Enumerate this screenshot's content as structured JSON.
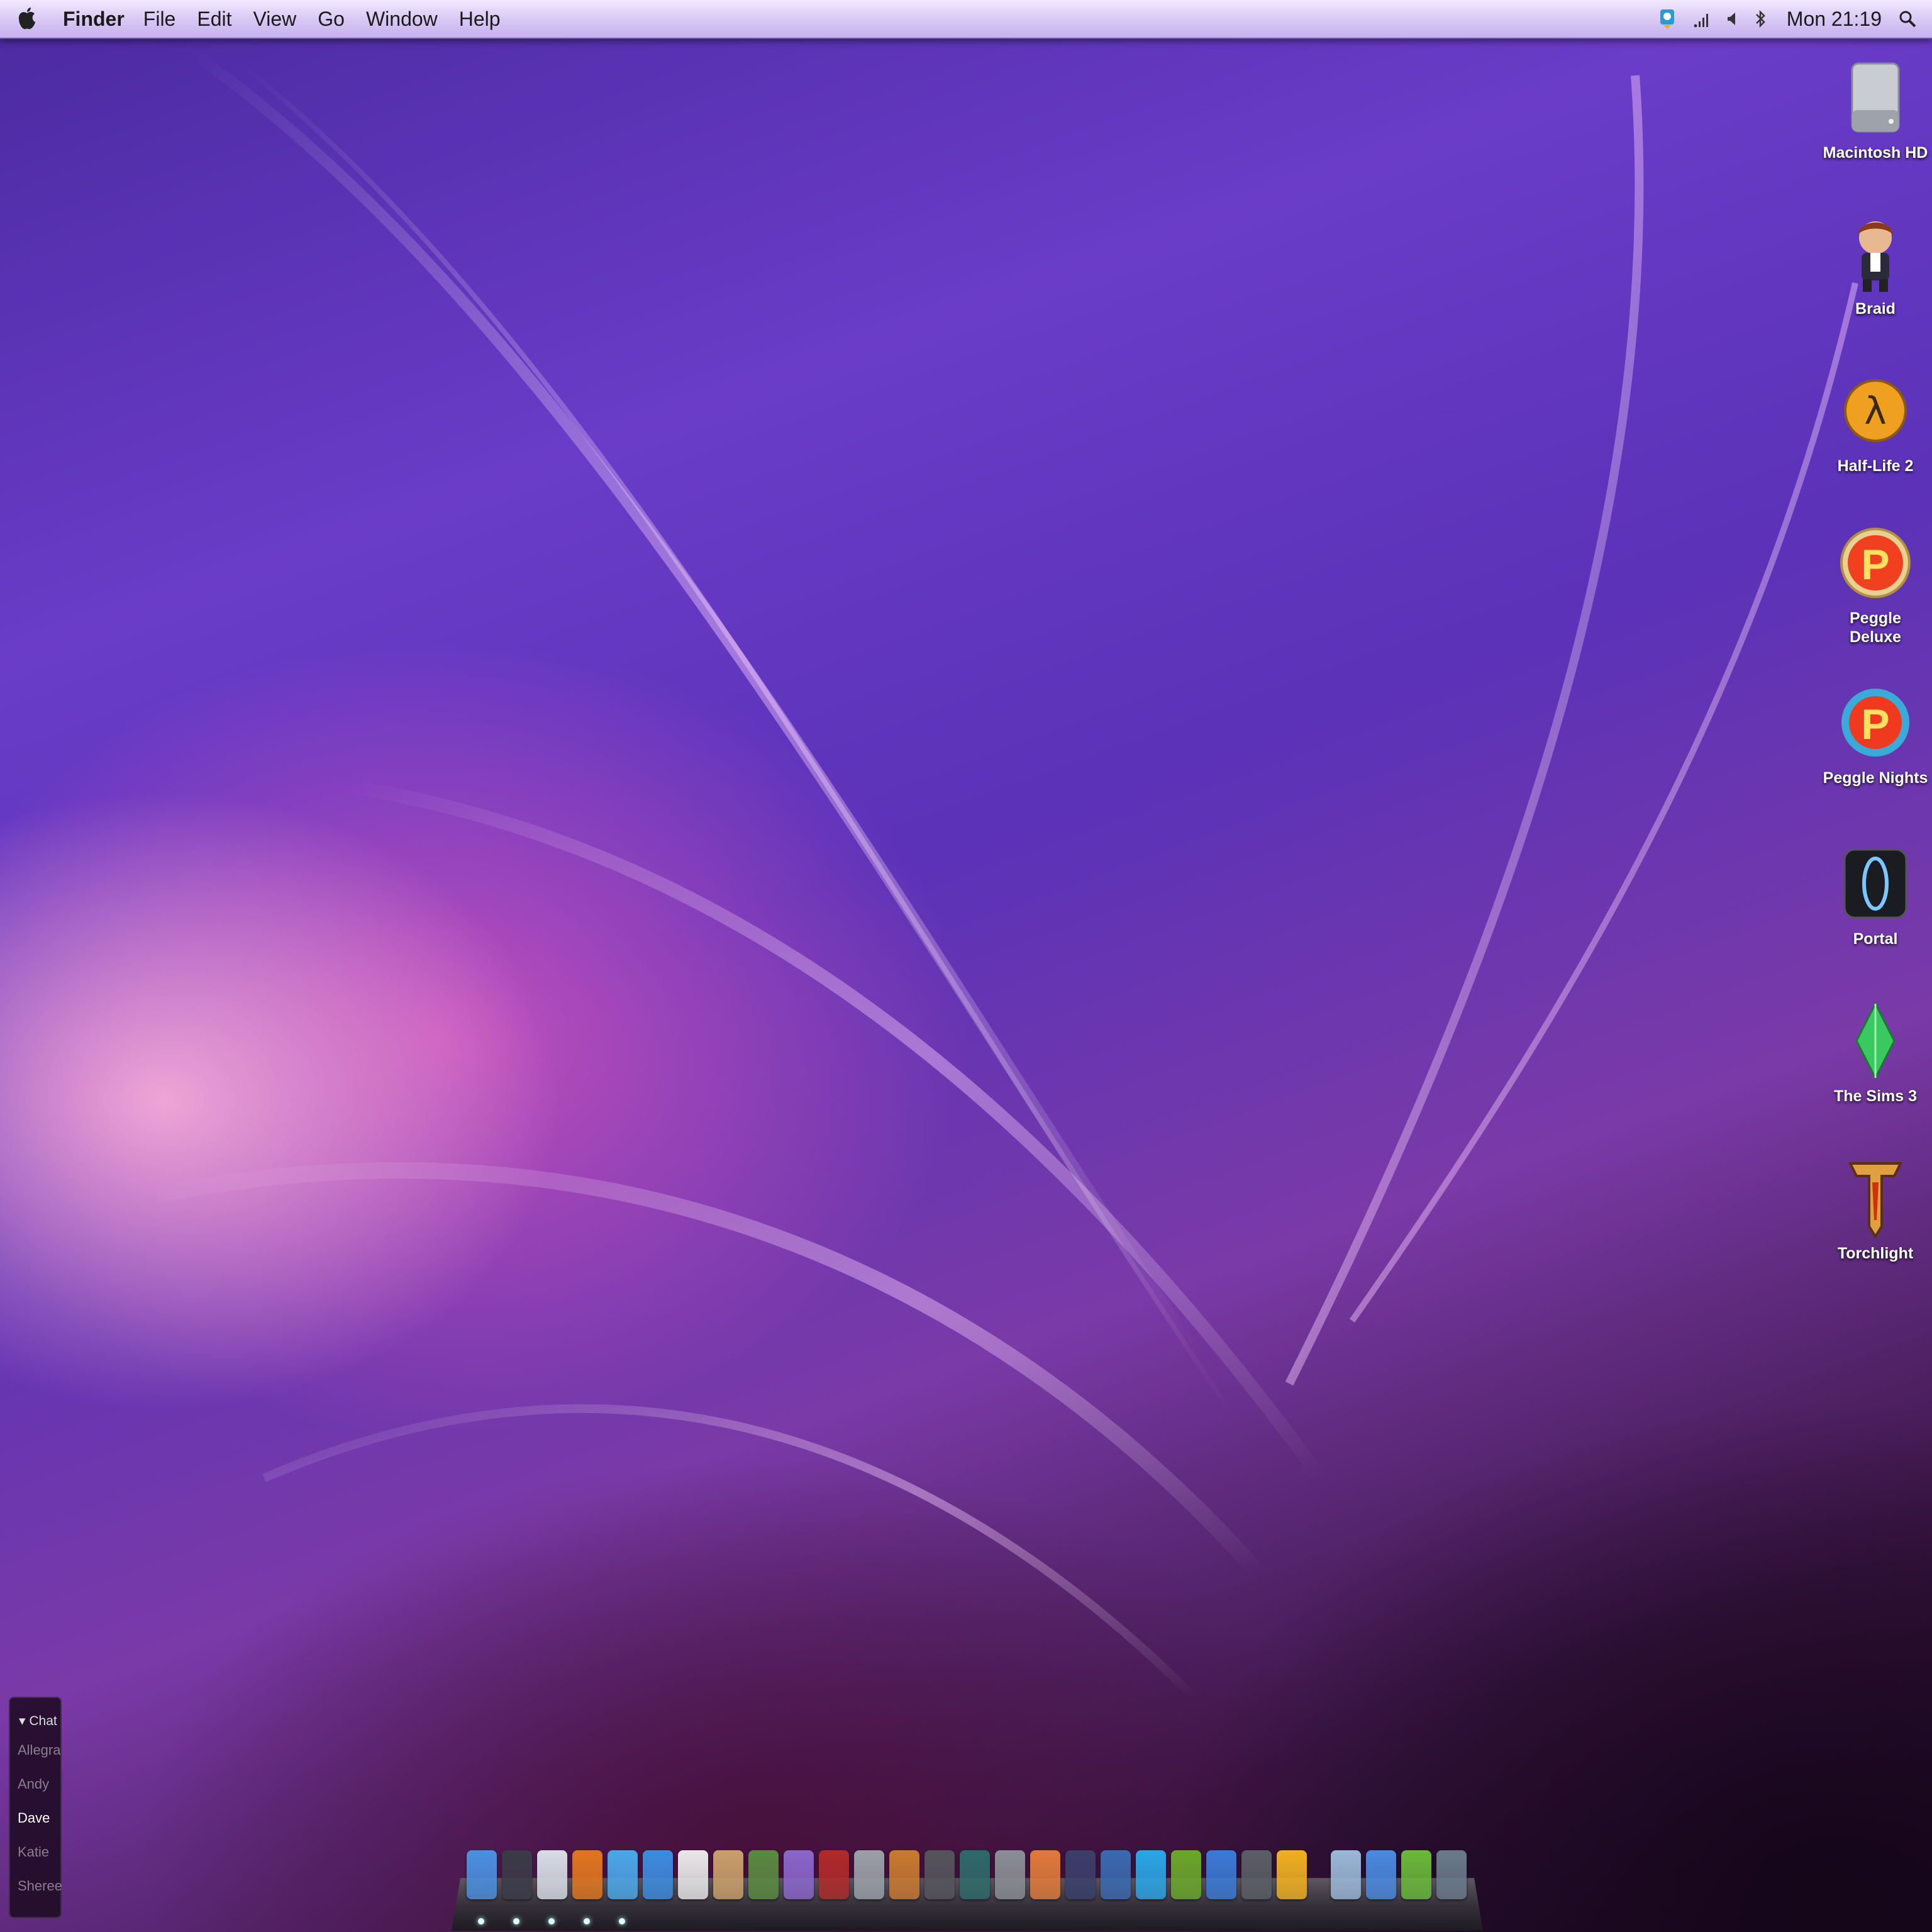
{
  "menubar": {
    "app_name": "Finder",
    "menus": [
      "File",
      "Edit",
      "View",
      "Go",
      "Window",
      "Help"
    ],
    "clock": "Mon 21:19",
    "status_icons": [
      "skype-status-icon",
      "wifi-signal-icon",
      "volume-icon",
      "bluetooth-icon",
      "spotlight-search-icon"
    ]
  },
  "desktop_icons": [
    {
      "label": "Macintosh HD",
      "icon": "hard-drive-icon"
    },
    {
      "label": "Braid",
      "icon": "braid-game-icon"
    },
    {
      "label": "Half-Life 2",
      "icon": "half-life-2-icon"
    },
    {
      "label": "Peggle Deluxe",
      "icon": "peggle-deluxe-icon"
    },
    {
      "label": "Peggle Nights",
      "icon": "peggle-nights-icon"
    },
    {
      "label": "Portal",
      "icon": "portal-icon"
    },
    {
      "label": "The Sims 3",
      "icon": "sims-3-icon"
    },
    {
      "label": "Torchlight",
      "icon": "torchlight-icon"
    }
  ],
  "chat": {
    "header": "▾ Chat",
    "contacts": [
      "Allegra",
      "Andy",
      "Dave",
      "Katie",
      "Sheree"
    ],
    "active_contact": "Dave"
  },
  "dock": {
    "apps": [
      {
        "icon": "finder-icon",
        "color": "#4a90e0"
      },
      {
        "icon": "launchpad-icon",
        "color": "#3a3a48"
      },
      {
        "icon": "mail-icon",
        "color": "#d8dde6"
      },
      {
        "icon": "firefox-icon",
        "color": "#e0761e"
      },
      {
        "icon": "ichat-icon",
        "color": "#4aa8ea"
      },
      {
        "icon": "facetime-icon",
        "color": "#3c8ce0"
      },
      {
        "icon": "ical-icon",
        "color": "#e8e8e8"
      },
      {
        "icon": "address-book-icon",
        "color": "#c9a06a"
      },
      {
        "icon": "iphoto-icon",
        "color": "#5a8a40"
      },
      {
        "icon": "itunes-icon",
        "color": "#8a66cc"
      },
      {
        "icon": "photo-booth-icon",
        "color": "#b02a2a"
      },
      {
        "icon": "dvd-player-icon",
        "color": "#9aa0a8"
      },
      {
        "icon": "preview-icon",
        "color": "#c87a30"
      },
      {
        "icon": "imovie-icon",
        "color": "#54545c"
      },
      {
        "icon": "time-machine-icon",
        "color": "#2e6a6a"
      },
      {
        "icon": "system-preferences-icon",
        "color": "#8a8e96"
      },
      {
        "icon": "pages-icon",
        "color": "#e07a3a"
      },
      {
        "icon": "xcode-icon",
        "color": "#3a3f6a"
      },
      {
        "icon": "numbers-icon",
        "color": "#3a6ab0"
      },
      {
        "icon": "skype-icon",
        "color": "#2aa6e6"
      },
      {
        "icon": "spotify-icon",
        "color": "#6aa82a"
      },
      {
        "icon": "textedit-icon",
        "color": "#3a7ad6"
      },
      {
        "icon": "steam-icon",
        "color": "#5a5e66"
      },
      {
        "icon": "script-editor-icon",
        "color": "#f0b020"
      }
    ],
    "stacks": [
      {
        "icon": "documents-stack-icon",
        "color": "#9ab8d8"
      },
      {
        "icon": "applications-stack-icon",
        "color": "#4a8ae0"
      },
      {
        "icon": "downloads-stack-icon",
        "color": "#6ab83a"
      },
      {
        "icon": "trash-icon",
        "color": "#6a7a8a"
      }
    ],
    "running_indicator_count": 5
  }
}
